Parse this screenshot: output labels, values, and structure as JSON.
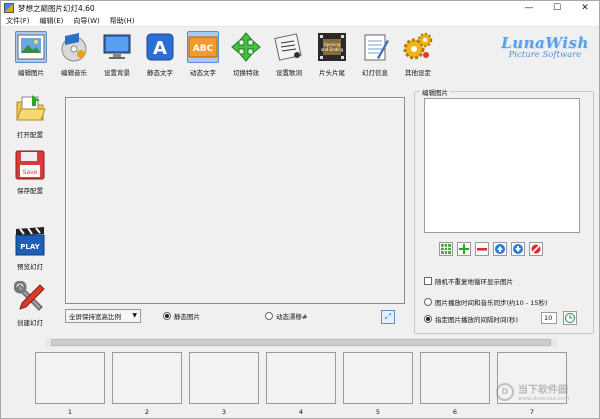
{
  "window": {
    "title": "梦想之巅图片幻灯4.60",
    "minimize": "—",
    "maximize": "☐",
    "close": "✕"
  },
  "menu": [
    "文件(F)",
    "编辑(E)",
    "向导(W)",
    "帮助(H)"
  ],
  "toolbar": [
    {
      "label": "编辑图片",
      "icon": "photo-icon"
    },
    {
      "label": "编辑音乐",
      "icon": "music-cd-icon"
    },
    {
      "label": "设置背景",
      "icon": "monitor-icon"
    },
    {
      "label": "静态文字",
      "icon": "letter-a-icon"
    },
    {
      "label": "动态文字",
      "icon": "abc-text-icon",
      "active": true
    },
    {
      "label": "切换特效",
      "icon": "arrows-icon"
    },
    {
      "label": "设置歌词",
      "icon": "lyrics-icon"
    },
    {
      "label": "片头片尾",
      "icon": "film-icon",
      "film_text": "Opening and Ending"
    },
    {
      "label": "幻灯信息",
      "icon": "notepad-icon"
    },
    {
      "label": "其他设定",
      "icon": "gears-icon"
    }
  ],
  "logo": {
    "line1": "LunaWish",
    "line2": "Picture Software"
  },
  "sidebar": [
    {
      "label": "打开配置",
      "icon": "open-folder-icon"
    },
    {
      "label": "保存配置",
      "icon": "floppy-save-icon",
      "badge": "Save"
    },
    {
      "label": "预览幻灯",
      "icon": "clapper-play-icon",
      "badge": "PLAY"
    },
    {
      "label": "创建幻灯",
      "icon": "tools-icon"
    }
  ],
  "controls": {
    "scale_select": "全屏保持宽高比例",
    "radio_static": "静态图片",
    "radio_dynamic": "动态漂移#"
  },
  "edit_panel": {
    "title": "编辑图片",
    "checkbox_label": "随机不重复地循环显示图片",
    "radio_sync": "图片播放时间和音乐同步(约10 - 15秒)",
    "radio_custom": "指定图片播放的间隔时间(秒)",
    "interval_value": "10"
  },
  "thumbnails": [
    "1",
    "2",
    "3",
    "4",
    "5",
    "6",
    "7"
  ],
  "watermark": {
    "text": "当下软件园",
    "sub": "www.downxia.com"
  },
  "colors": {
    "accent": "#3a86d9",
    "active_bg": "#a9c9f0"
  }
}
